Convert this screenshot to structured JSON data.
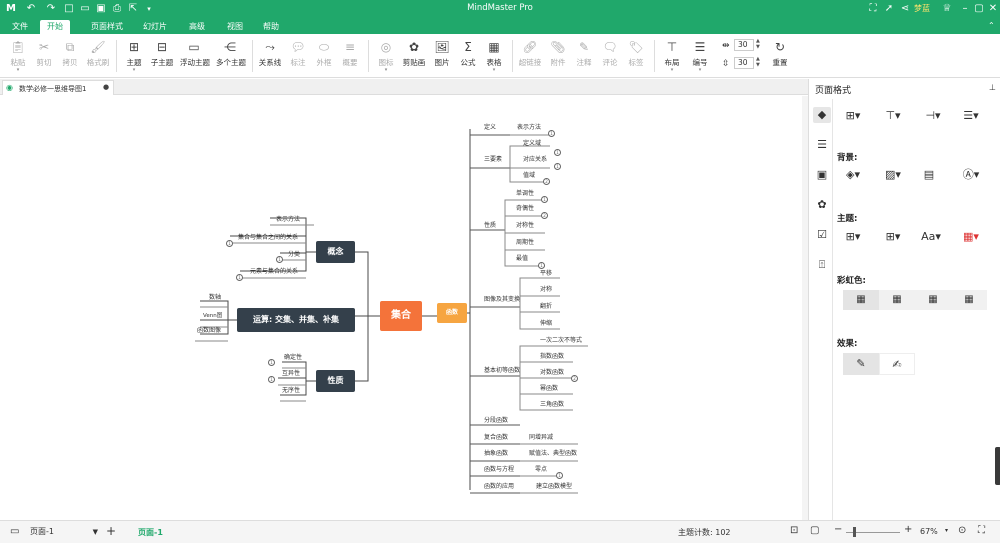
{
  "app": {
    "title": "MindMaster Pro",
    "user": "梦蓝"
  },
  "menu": {
    "items": [
      "文件",
      "开始",
      "页面样式",
      "幻灯片",
      "高级",
      "视图",
      "帮助"
    ]
  },
  "ribbon": {
    "paste": "粘贴",
    "cut": "剪切",
    "copy": "拷贝",
    "format_painter": "格式刷",
    "topic": "主题",
    "subtopic": "子主题",
    "floating": "浮动主题",
    "multiple": "多个主题",
    "relation": "关系线",
    "callout": "标注",
    "boundary": "外框",
    "summary": "概要",
    "icon": "图标",
    "clipart": "剪贴画",
    "image": "图片",
    "formula": "公式",
    "table": "表格",
    "hyperlink": "超链接",
    "attachment": "附件",
    "note": "注释",
    "comment": "评论",
    "tag": "标签",
    "layout": "布局",
    "numbering": "编号",
    "spacing1": "30",
    "spacing2": "30",
    "reset": "重置"
  },
  "doc": {
    "tab": "数学必修一思维导图1"
  },
  "panel": {
    "title": "页面格式",
    "background": "背景:",
    "theme": "主题:",
    "rainbow": "彩虹色:",
    "effect": "效果:"
  },
  "status": {
    "page_select": "页面-1",
    "page_tab": "页面-1",
    "topic_count": "主题计数:  102",
    "zoom": "67%"
  },
  "map": {
    "center": "集合",
    "concept": "概念",
    "operation": "运算: 交集、并集、补集",
    "property": "性质",
    "function": "函数",
    "concept_items": [
      "表示方法",
      "集合与集合之间的关系",
      "分类",
      "元素与集合的关系"
    ],
    "operation_items": [
      "数轴",
      "Venn图",
      "函数图像"
    ],
    "property_items": [
      "确定性",
      "互异性",
      "无序性"
    ],
    "fn": {
      "def": "定义",
      "def_sub": "表示方法",
      "three": "三要素",
      "three_subs": [
        "定义域",
        "对应关系",
        "值域"
      ],
      "prop": "性质",
      "prop_subs": [
        "单调性",
        "奇偶性",
        "对称性",
        "周期性",
        "最值"
      ],
      "graph": "图像及其变换",
      "graph_subs": [
        "平移",
        "对称",
        "翻折",
        "伸缩"
      ],
      "basic": "基本初等函数",
      "basic_subs": [
        "一次二次不等式",
        "指数函数",
        "对数函数",
        "幂函数",
        "三角函数"
      ],
      "piece": "分段函数",
      "comp": "复合函数",
      "comp_sub": "同增异减",
      "abs": "抽象函数",
      "abs_sub": "赋值法、典型函数",
      "eq": "函数与方程",
      "eq_sub": "零点",
      "app": "函数的应用",
      "app_sub": "建立函数模型"
    }
  },
  "colors": {
    "brand": "#20a86b",
    "center": "#f4733a",
    "main": "#34404b",
    "func": "#f6a541"
  }
}
